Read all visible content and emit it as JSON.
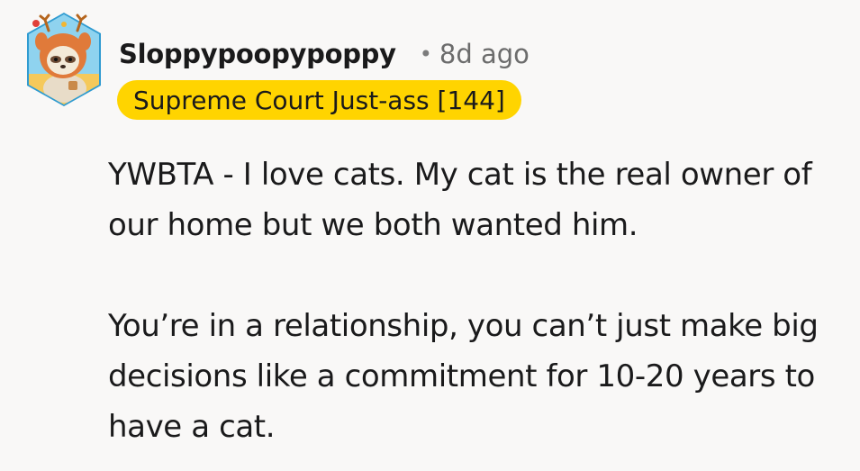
{
  "comment": {
    "username": "Sloppypoopypoppy",
    "separator": "•",
    "timestamp": "8d ago",
    "flair": "Supreme Court Just-ass [144]",
    "paragraphs": [
      "YWBTA - I love cats. My cat is the real owner of our home but we both wanted him.",
      "You’re in a relationship, you can’t just make big decisions like a commitment for 10-20 years to have a cat."
    ]
  },
  "colors": {
    "background": "#f9f8f7",
    "flair_background": "#ffd400",
    "avatar_frame": "#2f9bd1",
    "text": "#1a1a1b",
    "muted": "#6c6c6c"
  },
  "icons": {
    "avatar": "snoo-avatar-sloth-in-deer-costume-icon"
  }
}
